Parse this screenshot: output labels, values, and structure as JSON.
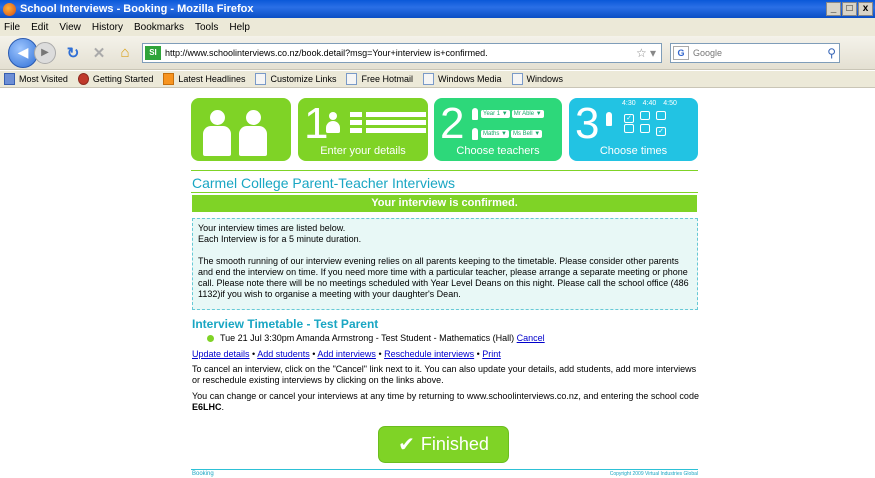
{
  "window": {
    "title": "School Interviews - Booking - Mozilla Firefox",
    "controls": [
      "_",
      "□",
      "x"
    ]
  },
  "menu": [
    "File",
    "Edit",
    "View",
    "History",
    "Bookmarks",
    "Tools",
    "Help"
  ],
  "nav": {
    "url": "http://www.schoolinterviews.co.nz/book.detail?msg=Your+interview is+confirmed.",
    "search_placeholder": "Google"
  },
  "bookmarks": [
    "Most Visited",
    "Getting Started",
    "Latest Headlines",
    "Customize Links",
    "Free Hotmail",
    "Windows Media",
    "Windows"
  ],
  "steps": {
    "s1_num": "1",
    "s1_label": "Enter your details",
    "s2_num": "2",
    "s2_label": "Choose teachers",
    "s2_tag1": "Year 1 ▼",
    "s2_tag2": "Mr Able ▼",
    "s2_tag3": "Maths ▼",
    "s2_tag4": "Ms Bell ▼",
    "s3_num": "3",
    "s3_label": "Choose times",
    "times": [
      "4:30",
      "4:40",
      "4:50"
    ]
  },
  "page": {
    "title": "Carmel College Parent-Teacher Interviews",
    "confirm": "Your interview is confirmed.",
    "info_l1": "Your interview times are listed below.",
    "info_l2": "Each Interview is for a 5 minute duration.",
    "info_p2": "The smooth running of our interview evening relies on all parents keeping to the timetable. Please consider other parents and end the interview on time. If you need more time with a particular teacher, please arrange a separate meeting or phone call. Please note there will be no meetings scheduled with Year Level Deans on this night. Please call the school office (486 1132)if you wish to organise a meeting with your daughter's Dean.",
    "timetable_title": "Interview Timetable - Test Parent",
    "appointment": "Tue 21 Jul 3:30pm Amanda Armstrong - Test Student - Mathematics (Hall)",
    "cancel": "Cancel",
    "links": {
      "update": "Update details",
      "add_students": "Add students",
      "add_interviews": "Add interviews",
      "reschedule": "Reschedule interviews",
      "print": "Print",
      "sep": " • "
    },
    "para1": "To cancel an interview, click on the \"Cancel\" link next to it. You can also update your details, add students, add more interviews or reschedule existing interviews by clicking on the links above.",
    "para2_pre": "You can change or cancel your interviews at any time by returning to www.schoolinterviews.co.nz, and entering the school code",
    "school_code": "E6LHC",
    "para2_post": ".",
    "finished": "Finished",
    "footer_left": "Booking",
    "footer_right": "Copyright 2009 Virtual Industries Global"
  }
}
